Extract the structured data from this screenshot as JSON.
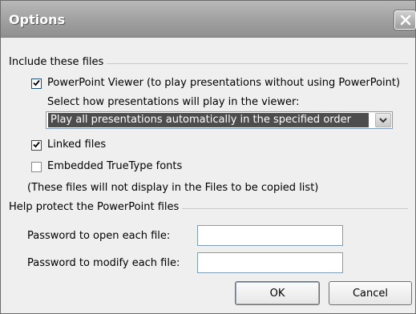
{
  "window": {
    "title": "Options"
  },
  "include_group": {
    "label": "Include these files",
    "viewer_checkbox": {
      "label": "PowerPoint Viewer (to play presentations without using PowerPoint)",
      "checked": true
    },
    "viewer_prompt": "Select how presentations will play in the viewer:",
    "viewer_dropdown": {
      "selected": "Play all presentations automatically in the specified order"
    },
    "linked_checkbox": {
      "label": "Linked files",
      "checked": true
    },
    "fonts_checkbox": {
      "label": "Embedded TrueType fonts",
      "checked": false
    },
    "note": "(These files will not display in the Files to be copied list)"
  },
  "protect_group": {
    "label": "Help protect the PowerPoint files",
    "open_password": {
      "label": "Password to open each file:",
      "value": ""
    },
    "modify_password": {
      "label": "Password to modify each file:",
      "value": ""
    }
  },
  "buttons": {
    "ok": "OK",
    "cancel": "Cancel"
  },
  "icons": {
    "close": "close-icon",
    "check": "checkmark-icon",
    "dropdown": "chevron-down-icon"
  }
}
